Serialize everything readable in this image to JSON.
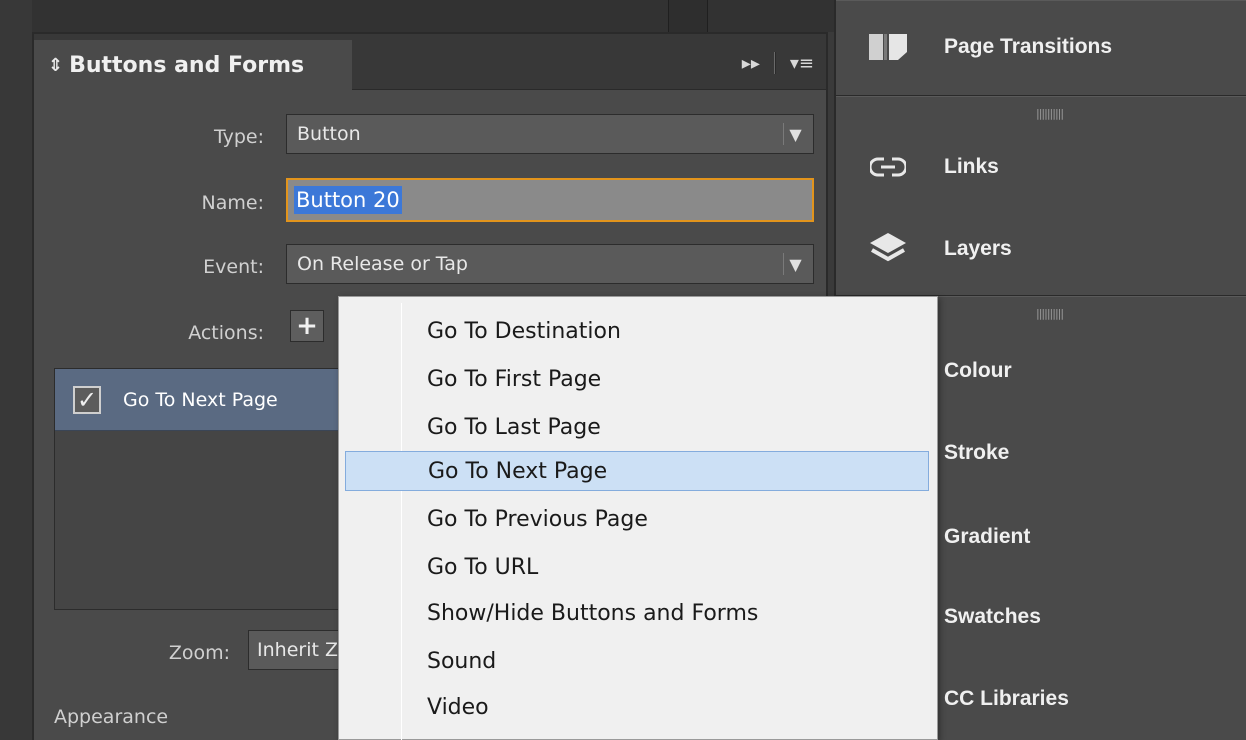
{
  "panel": {
    "title": "Buttons and Forms",
    "collapse_glyph": "⇕",
    "header_icons": {
      "expand": "▸▸",
      "menu": "▾≡"
    }
  },
  "form": {
    "type_label": "Type:",
    "type_value": "Button",
    "name_label": "Name:",
    "name_value": "Button 20",
    "event_label": "Event:",
    "event_value": "On Release or Tap",
    "actions_label": "Actions:",
    "add_action_glyph": "+",
    "zoom_label": "Zoom:",
    "zoom_value": "Inherit Z",
    "appearance_label": "Appearance"
  },
  "actions": [
    {
      "checked": true,
      "label": "Go To Next Page"
    }
  ],
  "dropdown_arrow": "▼",
  "checkmark": "✓",
  "dock": {
    "grip": "||||||||||",
    "top": [
      {
        "label": "Page Transitions",
        "icon": "page-transitions-icon"
      }
    ],
    "middle": [
      {
        "label": "Links",
        "icon": "links-icon"
      },
      {
        "label": "Layers",
        "icon": "layers-icon"
      }
    ],
    "bottom": [
      {
        "label": "Colour",
        "icon": "colour-icon"
      },
      {
        "label": "Stroke",
        "icon": "stroke-icon"
      },
      {
        "label": "Gradient",
        "icon": "gradient-icon"
      },
      {
        "label": "Swatches",
        "icon": "swatches-icon"
      },
      {
        "label": "CC Libraries",
        "icon": "cc-libraries-icon"
      }
    ]
  },
  "menu": {
    "items": [
      "Go To Destination",
      "Go To First Page",
      "Go To Last Page",
      "Go To Next Page",
      "Go To Previous Page",
      "Go To URL",
      "Show/Hide Buttons and Forms",
      "Sound",
      "Video"
    ],
    "highlighted_index": 3
  },
  "colors": {
    "accent_focus": "#e2941c",
    "selection": "#3c78d8",
    "menu_highlight": "#cce0f5"
  }
}
